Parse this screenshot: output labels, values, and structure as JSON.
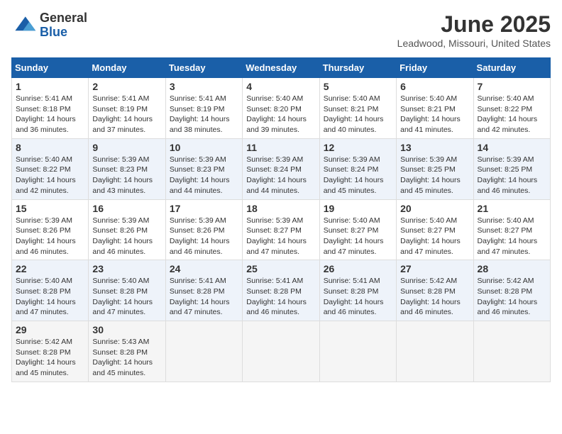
{
  "header": {
    "logo_general": "General",
    "logo_blue": "Blue",
    "month_title": "June 2025",
    "location": "Leadwood, Missouri, United States"
  },
  "weekdays": [
    "Sunday",
    "Monday",
    "Tuesday",
    "Wednesday",
    "Thursday",
    "Friday",
    "Saturday"
  ],
  "weeks": [
    [
      {
        "day": 1,
        "sunrise": "5:41 AM",
        "sunset": "8:18 PM",
        "daylight": "14 hours and 36 minutes."
      },
      {
        "day": 2,
        "sunrise": "5:41 AM",
        "sunset": "8:19 PM",
        "daylight": "14 hours and 37 minutes."
      },
      {
        "day": 3,
        "sunrise": "5:41 AM",
        "sunset": "8:19 PM",
        "daylight": "14 hours and 38 minutes."
      },
      {
        "day": 4,
        "sunrise": "5:40 AM",
        "sunset": "8:20 PM",
        "daylight": "14 hours and 39 minutes."
      },
      {
        "day": 5,
        "sunrise": "5:40 AM",
        "sunset": "8:21 PM",
        "daylight": "14 hours and 40 minutes."
      },
      {
        "day": 6,
        "sunrise": "5:40 AM",
        "sunset": "8:21 PM",
        "daylight": "14 hours and 41 minutes."
      },
      {
        "day": 7,
        "sunrise": "5:40 AM",
        "sunset": "8:22 PM",
        "daylight": "14 hours and 42 minutes."
      }
    ],
    [
      {
        "day": 8,
        "sunrise": "5:40 AM",
        "sunset": "8:22 PM",
        "daylight": "14 hours and 42 minutes."
      },
      {
        "day": 9,
        "sunrise": "5:39 AM",
        "sunset": "8:23 PM",
        "daylight": "14 hours and 43 minutes."
      },
      {
        "day": 10,
        "sunrise": "5:39 AM",
        "sunset": "8:23 PM",
        "daylight": "14 hours and 44 minutes."
      },
      {
        "day": 11,
        "sunrise": "5:39 AM",
        "sunset": "8:24 PM",
        "daylight": "14 hours and 44 minutes."
      },
      {
        "day": 12,
        "sunrise": "5:39 AM",
        "sunset": "8:24 PM",
        "daylight": "14 hours and 45 minutes."
      },
      {
        "day": 13,
        "sunrise": "5:39 AM",
        "sunset": "8:25 PM",
        "daylight": "14 hours and 45 minutes."
      },
      {
        "day": 14,
        "sunrise": "5:39 AM",
        "sunset": "8:25 PM",
        "daylight": "14 hours and 46 minutes."
      }
    ],
    [
      {
        "day": 15,
        "sunrise": "5:39 AM",
        "sunset": "8:26 PM",
        "daylight": "14 hours and 46 minutes."
      },
      {
        "day": 16,
        "sunrise": "5:39 AM",
        "sunset": "8:26 PM",
        "daylight": "14 hours and 46 minutes."
      },
      {
        "day": 17,
        "sunrise": "5:39 AM",
        "sunset": "8:26 PM",
        "daylight": "14 hours and 46 minutes."
      },
      {
        "day": 18,
        "sunrise": "5:39 AM",
        "sunset": "8:27 PM",
        "daylight": "14 hours and 47 minutes."
      },
      {
        "day": 19,
        "sunrise": "5:40 AM",
        "sunset": "8:27 PM",
        "daylight": "14 hours and 47 minutes."
      },
      {
        "day": 20,
        "sunrise": "5:40 AM",
        "sunset": "8:27 PM",
        "daylight": "14 hours and 47 minutes."
      },
      {
        "day": 21,
        "sunrise": "5:40 AM",
        "sunset": "8:27 PM",
        "daylight": "14 hours and 47 minutes."
      }
    ],
    [
      {
        "day": 22,
        "sunrise": "5:40 AM",
        "sunset": "8:28 PM",
        "daylight": "14 hours and 47 minutes."
      },
      {
        "day": 23,
        "sunrise": "5:40 AM",
        "sunset": "8:28 PM",
        "daylight": "14 hours and 47 minutes."
      },
      {
        "day": 24,
        "sunrise": "5:41 AM",
        "sunset": "8:28 PM",
        "daylight": "14 hours and 47 minutes."
      },
      {
        "day": 25,
        "sunrise": "5:41 AM",
        "sunset": "8:28 PM",
        "daylight": "14 hours and 46 minutes."
      },
      {
        "day": 26,
        "sunrise": "5:41 AM",
        "sunset": "8:28 PM",
        "daylight": "14 hours and 46 minutes."
      },
      {
        "day": 27,
        "sunrise": "5:42 AM",
        "sunset": "8:28 PM",
        "daylight": "14 hours and 46 minutes."
      },
      {
        "day": 28,
        "sunrise": "5:42 AM",
        "sunset": "8:28 PM",
        "daylight": "14 hours and 46 minutes."
      }
    ],
    [
      {
        "day": 29,
        "sunrise": "5:42 AM",
        "sunset": "8:28 PM",
        "daylight": "14 hours and 45 minutes."
      },
      {
        "day": 30,
        "sunrise": "5:43 AM",
        "sunset": "8:28 PM",
        "daylight": "14 hours and 45 minutes."
      },
      null,
      null,
      null,
      null,
      null
    ]
  ],
  "labels": {
    "sunrise": "Sunrise:",
    "sunset": "Sunset:",
    "daylight": "Daylight:"
  }
}
